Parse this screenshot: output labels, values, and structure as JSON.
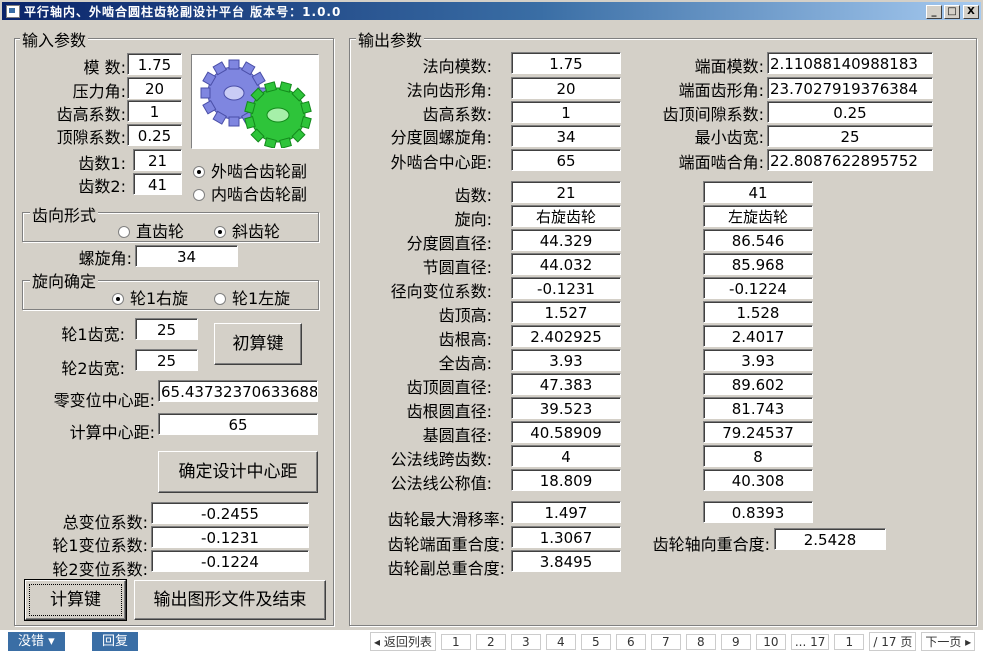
{
  "title": "平行轴内、外啮合圆柱齿轮副设计平台 版本号：1.0.0",
  "controls": {
    "min": "_",
    "max": "□",
    "close": "X"
  },
  "input": {
    "group_title": "输入参数",
    "modulus": {
      "label": "模 数:",
      "value": "1.75"
    },
    "pressure_angle": {
      "label": "压力角:",
      "value": "20"
    },
    "addendum_coef": {
      "label": "齿高系数:",
      "value": "1"
    },
    "clearance_coef": {
      "label": "顶隙系数:",
      "value": "0.25"
    },
    "teeth1": {
      "label": "齿数1:",
      "value": "21"
    },
    "teeth2": {
      "label": "齿数2:",
      "value": "41"
    },
    "mesh_external": "外啮合齿轮副",
    "mesh_internal": "内啮合齿轮副",
    "tooth_form_title": "齿向形式",
    "spur": "直齿轮",
    "helical": "斜齿轮",
    "helix_angle": {
      "label": "螺旋角:",
      "value": "34"
    },
    "hand_title": "旋向确定",
    "hand_right": "轮1右旋",
    "hand_left": "轮1左旋",
    "width1": {
      "label": "轮1齿宽:",
      "value": "25"
    },
    "width2": {
      "label": "轮2齿宽:",
      "value": "25"
    },
    "initial_calc_button": "初算键",
    "zero_center": {
      "label": "零变位中心距:",
      "value": "65.43732370633688"
    },
    "calc_center": {
      "label": "计算中心距:",
      "value": "65"
    },
    "confirm_center_button": "确定设计中心距",
    "total_shift": {
      "label": "总变位系数:",
      "value": "-0.2455"
    },
    "shift1": {
      "label": "轮1变位系数:",
      "value": "-0.1231"
    },
    "shift2": {
      "label": "轮2变位系数:",
      "value": "-0.1224"
    },
    "calc_button": "计算键",
    "export_button": "输出图形文件及结束"
  },
  "output": {
    "group_title": "输出参数",
    "top_left": [
      {
        "label": "法向模数:",
        "value": "1.75"
      },
      {
        "label": "法向齿形角:",
        "value": "20"
      },
      {
        "label": "齿高系数:",
        "value": "1"
      },
      {
        "label": "分度圆螺旋角:",
        "value": "34"
      },
      {
        "label": "外啮合中心距:",
        "value": "65"
      }
    ],
    "top_right": [
      {
        "label": "端面模数:",
        "value": "2.11088140988183"
      },
      {
        "label": "端面齿形角:",
        "value": "23.7027919376384"
      },
      {
        "label": "齿顶间隙系数:",
        "value": "0.25"
      },
      {
        "label": "最小齿宽:",
        "value": "25"
      },
      {
        "label": "端面啮合角:",
        "value": "22.8087622895752"
      }
    ],
    "rows": [
      {
        "label": "齿数:",
        "g1": "21",
        "g2": "41"
      },
      {
        "label": "旋向:",
        "g1": "右旋齿轮",
        "g2": "左旋齿轮"
      },
      {
        "label": "分度圆直径:",
        "g1": "44.329",
        "g2": "86.546"
      },
      {
        "label": "节圆直径:",
        "g1": "44.032",
        "g2": "85.968"
      },
      {
        "label": "径向变位系数:",
        "g1": "-0.1231",
        "g2": "-0.1224"
      },
      {
        "label": "齿顶高:",
        "g1": "1.527",
        "g2": "1.528"
      },
      {
        "label": "齿根高:",
        "g1": "2.402925",
        "g2": "2.4017"
      },
      {
        "label": "全齿高:",
        "g1": "3.93",
        "g2": "3.93"
      },
      {
        "label": "齿顶圆直径:",
        "g1": "47.383",
        "g2": "89.602"
      },
      {
        "label": "齿根圆直径:",
        "g1": "39.523",
        "g2": "81.743"
      },
      {
        "label": "基圆直径:",
        "g1": "40.58909",
        "g2": "79.24537"
      },
      {
        "label": "公法线跨齿数:",
        "g1": "4",
        "g2": "8"
      },
      {
        "label": "公法线公称值:",
        "g1": "18.809",
        "g2": "40.308"
      }
    ],
    "max_slip": {
      "label": "齿轮最大滑移率:",
      "g1": "1.497",
      "g2": "0.8393"
    },
    "transverse_contact": {
      "label": "齿轮端面重合度:",
      "value": "1.3067"
    },
    "axial_contact": {
      "label": "齿轮轴向重合度:",
      "value": "2.5428"
    },
    "total_contact": {
      "label": "齿轮副总重合度:",
      "value": "3.8495"
    }
  },
  "taskbar": {
    "btn1": "没错 ▾",
    "btn2": "回复",
    "pager": [
      "◂ 返回列表",
      "1",
      "2",
      "3",
      "4",
      "5",
      "6",
      "7",
      "8",
      "9",
      "10",
      "... 17",
      "1",
      "/ 17 页",
      "下一页 ▸"
    ]
  }
}
